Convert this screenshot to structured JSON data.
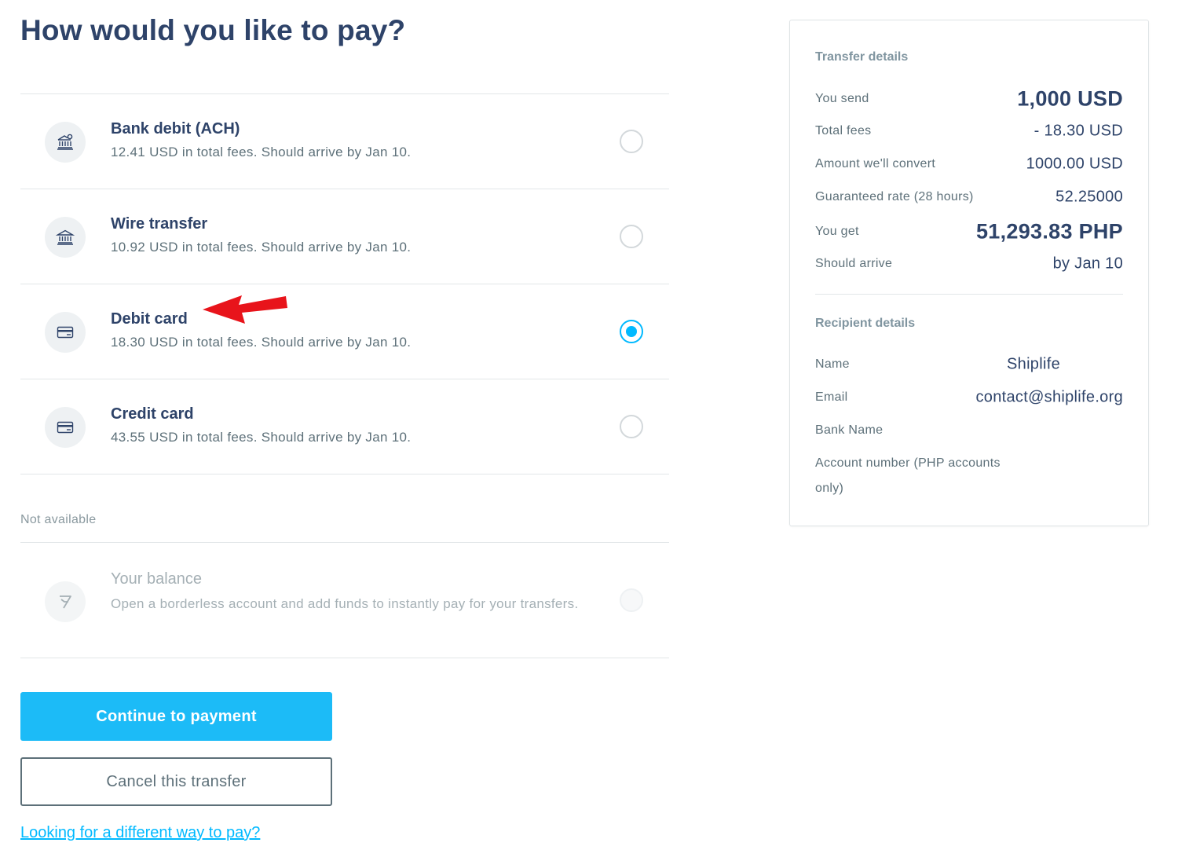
{
  "page": {
    "title": "How would you like to pay?"
  },
  "payment_options": [
    {
      "icon": "bank-debit-icon",
      "title": "Bank debit (ACH)",
      "description": "12.41 USD in total fees. Should arrive by Jan 10.",
      "selected": false
    },
    {
      "icon": "bank-icon",
      "title": "Wire transfer",
      "description": "10.92 USD in total fees. Should arrive by Jan 10.",
      "selected": false
    },
    {
      "icon": "card-icon",
      "title": "Debit card",
      "description": "18.30 USD in total fees. Should arrive by Jan 10.",
      "selected": true
    },
    {
      "icon": "card-icon",
      "title": "Credit card",
      "description": "43.55 USD in total fees. Should arrive by Jan 10.",
      "selected": false
    }
  ],
  "unavailable": {
    "heading": "Not available",
    "items": [
      {
        "icon": "borderless-logo-icon",
        "title": "Your balance",
        "description": "Open a borderless account and add funds to instantly pay for your transfers."
      }
    ]
  },
  "actions": {
    "continue_label": "Continue to payment",
    "cancel_label": "Cancel this transfer",
    "alt_link": "Looking for a different way to pay?"
  },
  "transfer_details": {
    "heading": "Transfer details",
    "you_send_label": "You send",
    "you_send_value": "1,000 USD",
    "total_fees_label": "Total fees",
    "total_fees_value": "- 18.30 USD",
    "convert_label": "Amount we'll convert",
    "convert_value": "1000.00 USD",
    "rate_label": "Guaranteed rate (28 hours)",
    "rate_value": "52.25000",
    "you_get_label": "You get",
    "you_get_value": "51,293.83 PHP",
    "arrive_label": "Should arrive",
    "arrive_value": "by Jan 10"
  },
  "recipient_details": {
    "heading": "Recipient details",
    "name_label": "Name",
    "name_value": "Shiplife",
    "email_label": "Email",
    "email_value": "contact@shiplife.org",
    "bank_label": "Bank Name",
    "account_label_line1": "Account number (PHP accounts",
    "account_label_line2": "only)"
  },
  "colors": {
    "primary": "#1cbbf7",
    "accent": "#00b9ff",
    "text_dark": "#2e4369",
    "text_muted": "#5d7079",
    "annotation_arrow": "#e8141b"
  }
}
